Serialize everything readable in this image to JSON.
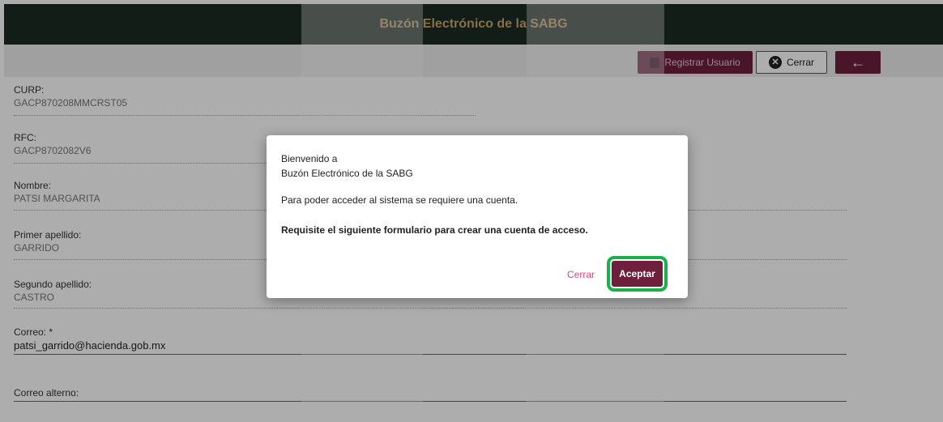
{
  "header": {
    "title": "Buzón Electrónico de la SABG"
  },
  "toolbar": {
    "register_label": "Registrar Usuario",
    "close_label": "Cerrar",
    "back_icon": "←"
  },
  "form": {
    "curp_label": "CURP:",
    "curp_value": "GACP870208MMCRST05",
    "rfc_label": "RFC:",
    "rfc_value": "GACP8702082V6",
    "nombre_label": "Nombre:",
    "nombre_value": "PATSI MARGARITA",
    "primer_label": "Primer apellido:",
    "primer_value": "GARRIDO",
    "segundo_label": "Segundo apellido:",
    "segundo_value": "CASTRO",
    "correo_label": "Correo: *",
    "correo_value": "patsi_garrido@hacienda.gob.mx",
    "alterno_label": "Correo alterno:"
  },
  "dialog": {
    "line1": "Bienvenido a",
    "line2": "Buzón Electrónico de la SABG",
    "line3": "Para poder acceder al sistema se requiere una cuenta.",
    "line4": "Requisite el siguiente formulario para crear una cuenta de acceso.",
    "close_label": "Cerrar",
    "accept_label": "Aceptar"
  },
  "colors": {
    "brand": "#6d1f3c",
    "header_bg": "#1d2b23",
    "title_gold": "#c8a46e",
    "highlight": "#18b14a"
  }
}
